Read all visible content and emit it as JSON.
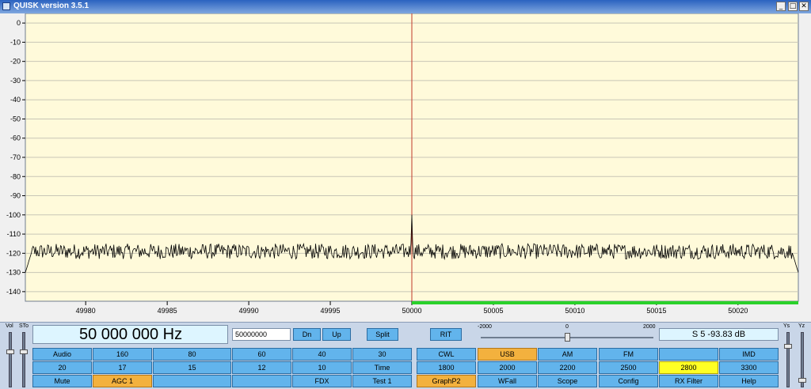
{
  "window": {
    "title": "QUISK version 3.5.1"
  },
  "graph": {
    "y_ticks": [
      "0",
      "-10",
      "-20",
      "-30",
      "-40",
      "-50",
      "-60",
      "-70",
      "-80",
      "-90",
      "-100",
      "-110",
      "-120",
      "-130",
      "-140"
    ],
    "x_ticks": [
      "49980",
      "49985",
      "49990",
      "49995",
      "50000",
      "50005",
      "50010",
      "50015",
      "50020"
    ]
  },
  "chart_data": {
    "type": "line",
    "x_range_khz": [
      49976.3,
      50023.7
    ],
    "y_range_db": [
      -145,
      5
    ],
    "y_ticks": [
      0,
      -10,
      -20,
      -30,
      -40,
      -50,
      -60,
      -70,
      -80,
      -90,
      -100,
      -110,
      -120,
      -130,
      -140
    ],
    "x_ticks": [
      49980,
      49985,
      49990,
      49995,
      50000,
      50005,
      50010,
      50015,
      50020
    ],
    "noise_floor_db": -119,
    "noise_spread_db": 4,
    "edge_db": -130,
    "peak": {
      "x": 50000,
      "y": -100
    },
    "tuning_marker_x": 50000,
    "passband_khz": [
      50000,
      50023.7
    ],
    "grid": true,
    "colors": {
      "background": "#fffada",
      "grid": "#c8c6b6",
      "trace": "#000000",
      "marker": "#c0392b",
      "passband": "#2ad12a"
    }
  },
  "controls": {
    "frequency_display": "50 000 000 Hz",
    "frequency_entry": "50000000",
    "dn": "Dn",
    "up": "Up",
    "split": "Split",
    "rit": "RIT",
    "slider_min": "-2000",
    "slider_mid": "0",
    "slider_max": "2000",
    "smeter": "S 5   -93.83 dB",
    "vol_label": "Vol",
    "sto_label": "STo",
    "ys_label": "Ys",
    "yz_label": "Yz",
    "row1": [
      "Audio",
      "160",
      "80",
      "60",
      "40",
      "30",
      "CWL",
      "USB",
      "AM",
      "FM",
      "",
      "IMD"
    ],
    "row2": [
      "20",
      "17",
      "15",
      "12",
      "10",
      "Time",
      "1800",
      "2000",
      "2200",
      "2500",
      "2800",
      "3300"
    ],
    "row3": [
      "Mute",
      "AGC 1",
      "",
      "",
      "FDX",
      "Test 1",
      "GraphP2",
      "WFall",
      "Scope",
      "Config",
      "RX Filter",
      "Help"
    ]
  }
}
